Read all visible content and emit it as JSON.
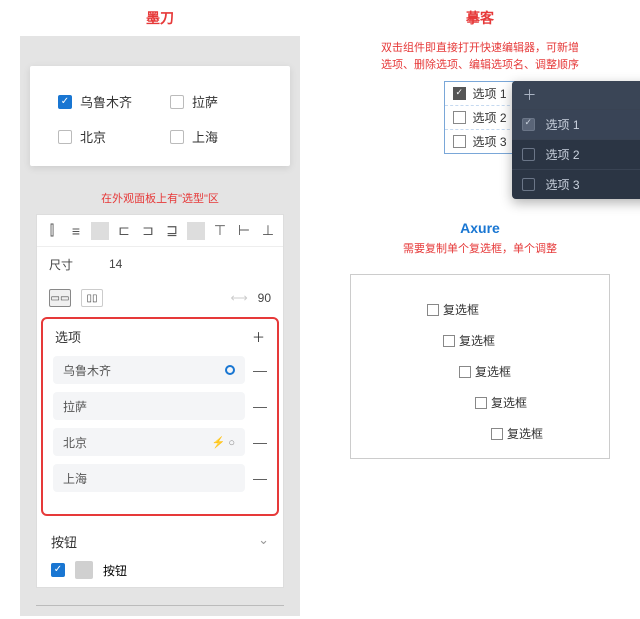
{
  "modao": {
    "title": "墨刀",
    "checkboxes": [
      {
        "label": "乌鲁木齐",
        "checked": true
      },
      {
        "label": "拉萨",
        "checked": false
      },
      {
        "label": "北京",
        "checked": false
      },
      {
        "label": "上海",
        "checked": false
      }
    ],
    "subtitle": "在外观面板上有\"选型\"区",
    "size_label": "尺寸",
    "size_value": "14",
    "spacing_value": "90",
    "options_header": "选项",
    "options": [
      {
        "text": "乌鲁木齐",
        "selected": true,
        "lightning": false
      },
      {
        "text": "拉萨",
        "selected": false,
        "lightning": false
      },
      {
        "text": "北京",
        "selected": false,
        "lightning": true
      },
      {
        "text": "上海",
        "selected": false,
        "lightning": false
      }
    ],
    "button_header": "按钮",
    "button_label": "按钮"
  },
  "mockplus": {
    "title": "摹客",
    "subtitle": "双击组件即直接打开快速编辑器，可新增\n选项、删除选项、编辑选项名、调整顺序",
    "list": [
      {
        "label": "选项 1",
        "checked": true
      },
      {
        "label": "选项 2",
        "checked": false
      },
      {
        "label": "选项 3",
        "checked": false
      }
    ],
    "editor_items": [
      {
        "label": "选项 1",
        "checked": true,
        "selected": true
      },
      {
        "label": "选项 2",
        "checked": false,
        "selected": false
      },
      {
        "label": "选项 3",
        "checked": false,
        "selected": false
      }
    ]
  },
  "axure": {
    "title": "Axure",
    "subtitle": "需要复制单个复选框，单个调整",
    "items": [
      "复选框",
      "复选框",
      "复选框",
      "复选框",
      "复选框"
    ],
    "indents": [
      76,
      92,
      108,
      124,
      140
    ]
  }
}
